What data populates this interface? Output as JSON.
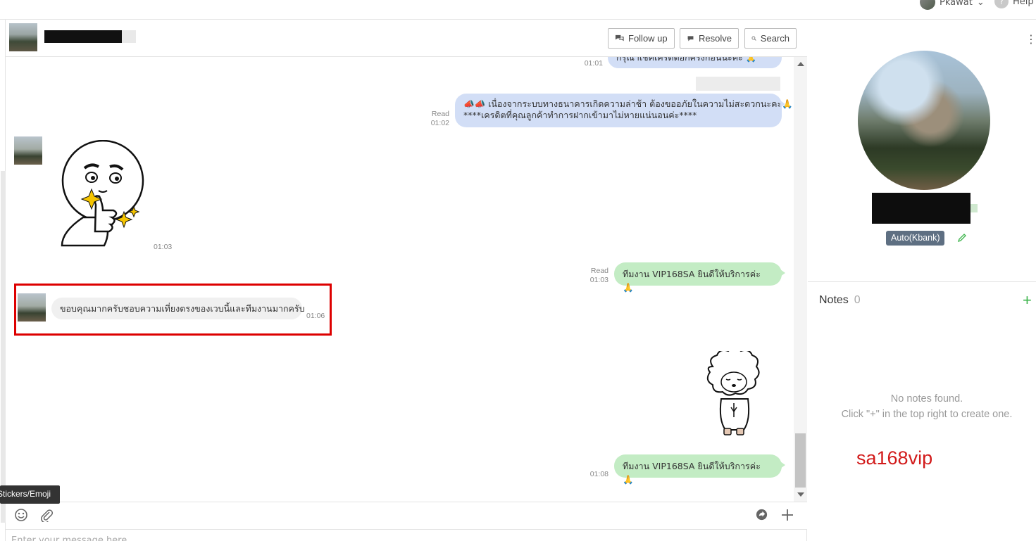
{
  "topbar": {
    "user_name": "Pkawat",
    "help_label": "Help"
  },
  "chat": {
    "header": {
      "follow_up_label": "Follow up",
      "resolve_label": "Resolve",
      "search_label": "Search"
    },
    "messages": {
      "m1_text": "กรุณาเช็คเครดิตอีกครั้งก่อนนะคะ 🙏",
      "m1_time": "01:01",
      "m2_text_line1": "📣📣 เนื่องจากระบบทางธนาคารเกิดความล่าช้า ต้องขออภัยในความไม่สะดวกนะคะ🙏",
      "m2_text_line2": "****เครดิตที่คุณลูกค้าทำการฝากเข้ามาไม่หายแน่นอนค่ะ****",
      "m2_status": "Read",
      "m2_time": "01:02",
      "sticker1_time": "01:03",
      "m3_text": "ทีมงาน VIP168SA ยินดีให้บริการค่ะ 🙏",
      "m3_status": "Read",
      "m3_time": "01:03",
      "m4_text": "ขอบคุณมากครับชอบความเที่ยงตรงของเวบนี้และทีมงานมากครับ",
      "m4_time": "01:06",
      "m5_text": "ทีมงาน VIP168SA ยินดีให้บริการค่ะ 🙏",
      "m5_time": "01:08"
    },
    "compose": {
      "tooltip": "Stickers/Emoji",
      "placeholder": "Enter your message here"
    }
  },
  "profile": {
    "tag": "Auto(Kbank)",
    "notes_title": "Notes",
    "notes_count": "0",
    "notes_add": "+",
    "no_notes_line1": "No notes found.",
    "no_notes_line2": "Click \"+\" in the top right to create one.",
    "watermark": "sa168vip"
  },
  "colors": {
    "blue_bubble": "#d2def6",
    "green_bubble": "#c3ecc4",
    "highlight": "#dd0000",
    "tag_bg": "#5e6f82",
    "watermark": "#d21b1b"
  }
}
